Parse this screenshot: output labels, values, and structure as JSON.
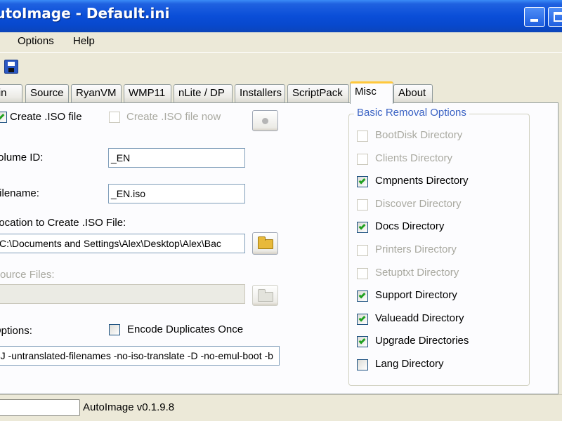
{
  "window": {
    "title": "AutoImage - Default.ini"
  },
  "menu": {
    "items": [
      "Options",
      "Help"
    ]
  },
  "toolbar": {
    "save_icon": "floppy-disk-icon"
  },
  "tabs": [
    {
      "label": "Main"
    },
    {
      "label": "Source"
    },
    {
      "label": "RyanVM"
    },
    {
      "label": "WMP11"
    },
    {
      "label": "nLite / DP"
    },
    {
      "label": "Installers"
    },
    {
      "label": "ScriptPack"
    },
    {
      "label": "Misc",
      "active": true
    },
    {
      "label": "About"
    }
  ],
  "misc": {
    "create_iso_label": "Create .ISO file",
    "create_iso_checked": true,
    "create_iso_now_label": "Create .ISO file now",
    "create_iso_now_checked": false,
    "volume_id_label": "Volume ID:",
    "volume_id_value": "_EN",
    "filename_label": "Filename:",
    "filename_value": "_EN.iso",
    "location_label": "Location to Create .ISO File:",
    "location_value": "C:\\Documents and Settings\\Alex\\Desktop\\Alex\\Bac",
    "source_files_label": "Source Files:",
    "source_files_value": "",
    "options_label": "Options:",
    "encode_duplicates_label": "Encode Duplicates Once",
    "encode_duplicates_checked": false,
    "options_value": "-J -untranslated-filenames -no-iso-translate -D -no-emul-boot -b"
  },
  "removal": {
    "title": "Basic Removal Options",
    "items": [
      {
        "label": "BootDisk Directory",
        "checked": false,
        "enabled": false
      },
      {
        "label": "Clients Directory",
        "checked": false,
        "enabled": false
      },
      {
        "label": "Cmpnents Directory",
        "checked": true,
        "enabled": true
      },
      {
        "label": "Discover Directory",
        "checked": false,
        "enabled": false
      },
      {
        "label": "Docs Directory",
        "checked": true,
        "enabled": true
      },
      {
        "label": "Printers Directory",
        "checked": false,
        "enabled": false
      },
      {
        "label": "Setuptxt Directory",
        "checked": false,
        "enabled": false
      },
      {
        "label": "Support Directory",
        "checked": true,
        "enabled": true
      },
      {
        "label": "Valueadd Directory",
        "checked": true,
        "enabled": true
      },
      {
        "label": "Upgrade Directories",
        "checked": true,
        "enabled": true
      },
      {
        "label": "Lang Directory",
        "checked": false,
        "enabled": true
      }
    ]
  },
  "status": {
    "version_text": "AutoImage v0.1.9.8"
  }
}
